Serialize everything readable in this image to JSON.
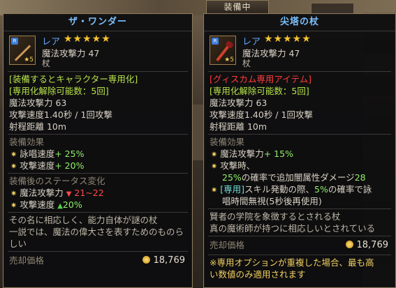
{
  "equipped_tab": "装備中",
  "left": {
    "title": "ザ・ワンダー",
    "rarity": "レア",
    "stars": "★★★★★",
    "level": "5",
    "magic_attack": "魔法攻撃力 47",
    "category": "杖",
    "special_line": "[装備するとキャラクター専用化]",
    "unbind_line": "[専用化解除可能数：5回]",
    "stats": [
      "魔法攻撃力 63",
      "攻撃速度1.40秒 / 1回攻撃",
      "射程距離 10m"
    ],
    "effect_title": "装備効果",
    "effects": [
      {
        "name": "詠唱速度",
        "value": "+ 25%"
      },
      {
        "name": "攻撃速度",
        "value": "+ 20%"
      }
    ],
    "change_title": "装備後のステータス変化",
    "changes": [
      {
        "name": "魔法攻撃力",
        "from": "21",
        "sep": "~",
        "to": "22"
      },
      {
        "name": "攻撃速度",
        "to": "20%"
      }
    ],
    "description": [
      "その名に相応しく、能力自体が謎の杖",
      "一説では、魔法の偉大さを表すためのものら",
      "しい"
    ],
    "sell_label": "売却価格",
    "sell_price": "18,769"
  },
  "right": {
    "title": "尖塔の杖",
    "rarity": "レア",
    "stars": "★★★★★",
    "level": "5",
    "magic_attack": "魔法攻撃力 47",
    "category": "杖",
    "special_line": "[グィスカム専用アイテム]",
    "unbind_line": "[専用化解除可能数：5回]",
    "stats": [
      "魔法攻撃力 63",
      "攻撃速度1.40秒 / 1回攻撃",
      "射程距離 10m"
    ],
    "effect_title": "装備効果",
    "effect1_name": "魔法攻撃力",
    "effect1_value": "+ 15%",
    "effect2_line1": "攻撃時、",
    "effect2_pct": "25%",
    "effect2_text": "の確率で追加闇属性ダメージ",
    "effect2_value": "28",
    "effect3_tag": "[専用]",
    "effect3_text": "スキル発動の際、",
    "effect3_pct": "5%",
    "effect3_text2": "の確率で詠",
    "effect3_line2": "唱時間無視(5秒後再使用)",
    "description": [
      "賢者の学院を象徴するとされる杖",
      "真の魔術師が持つに相応しいとされている"
    ],
    "sell_label": "売却価格",
    "sell_price": "18,769",
    "note": [
      "※専用オプションが重複した場合、最も高",
      "い数値のみ適用されます"
    ]
  },
  "colors": {
    "blue_title": "#7bc0ff",
    "green": "#b6e34a",
    "red": "#ff3b3b",
    "gold": "#f4c430"
  }
}
